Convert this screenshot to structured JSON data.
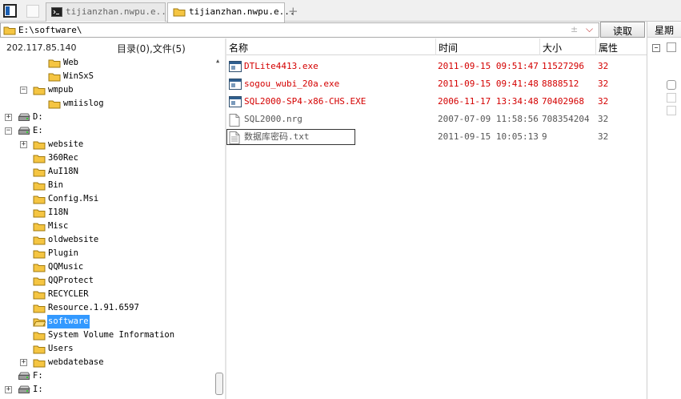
{
  "tabs": [
    {
      "label": "tijianzhan.nwpu.e...",
      "type": "terminal"
    },
    {
      "label": "tijianzhan.nwpu.e...",
      "type": "folder",
      "active": true
    }
  ],
  "tab_add": "+",
  "address": {
    "value": "E:\\software\\",
    "extra": "±"
  },
  "read_button": "读取",
  "right_panel": {
    "header": "星期"
  },
  "left_info": {
    "ip": "202.117.85.140",
    "counts": "目录(0),文件(5)"
  },
  "tree": [
    {
      "label": "Web"
    },
    {
      "label": "WinSxS"
    },
    {
      "label": "wmpub"
    },
    {
      "label": "wmiislog"
    },
    {
      "label": "D:"
    },
    {
      "label": "E:"
    },
    {
      "label": "website"
    },
    {
      "label": "360Rec"
    },
    {
      "label": "AuI18N"
    },
    {
      "label": "Bin"
    },
    {
      "label": "Config.Msi"
    },
    {
      "label": "I18N"
    },
    {
      "label": "Misc"
    },
    {
      "label": "oldwebsite"
    },
    {
      "label": "Plugin"
    },
    {
      "label": "QQMusic"
    },
    {
      "label": "QQProtect"
    },
    {
      "label": "RECYCLER"
    },
    {
      "label": "Resource.1.91.6597"
    },
    {
      "label": "software",
      "selected": true
    },
    {
      "label": "System Volume Information"
    },
    {
      "label": "Users"
    },
    {
      "label": "webdatebase"
    },
    {
      "label": "F:"
    },
    {
      "label": "I:"
    }
  ],
  "columns": {
    "name": "名称",
    "time": "时间",
    "size": "大小",
    "attr": "属性"
  },
  "files": [
    {
      "name": "DTLite4413.exe",
      "time": "2011-09-15 09:51:47",
      "size": "11527296",
      "attr": "32",
      "icon": "exe-icon",
      "color": "#d40000"
    },
    {
      "name": "sogou_wubi_20a.exe",
      "time": "2011-09-15 09:41:48",
      "size": "8888512",
      "attr": "32",
      "icon": "exe-icon",
      "color": "#d40000"
    },
    {
      "name": "SQL2000-SP4-x86-CHS.EXE",
      "time": "2006-11-17 13:34:48",
      "size": "70402968",
      "attr": "32",
      "icon": "exe-icon",
      "color": "#d40000"
    },
    {
      "name": "SQL2000.nrg",
      "time": "2007-07-09 11:58:56",
      "size": "708354204",
      "attr": "32",
      "icon": "file-icon",
      "color": "#555555"
    },
    {
      "name": "数据库密码.txt",
      "time": "2011-09-15 10:05:13",
      "size": "9",
      "attr": "32",
      "icon": "text-file-icon",
      "color": "#555555"
    }
  ],
  "colors": {
    "accent": "#3399ff",
    "exe_text": "#d40000",
    "folder": "#f5c542"
  }
}
